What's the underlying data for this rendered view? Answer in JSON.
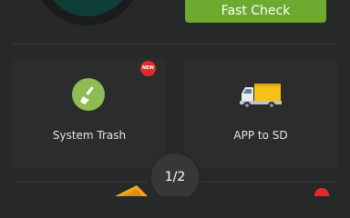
{
  "header": {
    "fast_check_label": "Fast Check"
  },
  "tiles": [
    {
      "label": "System Trash",
      "badge": "NEW",
      "icon": "broom-icon"
    },
    {
      "label": "APP to SD",
      "icon": "truck-icon"
    }
  ],
  "pager": {
    "label": "1/2"
  },
  "colors": {
    "background": "#272828",
    "accent_green": "#6cab2f",
    "badge_red": "#e32a2a"
  }
}
